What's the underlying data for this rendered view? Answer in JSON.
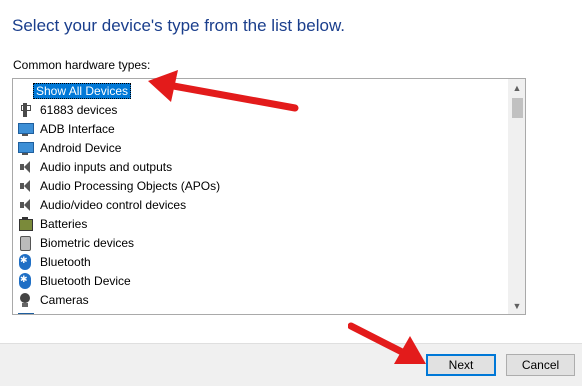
{
  "heading": "Select your device's type from the list below.",
  "section_label": "Common hardware types:",
  "list": {
    "items": [
      {
        "label": "Show All Devices",
        "icon": "none",
        "selected": true
      },
      {
        "label": "61883 devices",
        "icon": "usb-plug-icon"
      },
      {
        "label": "ADB Interface",
        "icon": "monitor-icon"
      },
      {
        "label": "Android Device",
        "icon": "monitor-icon"
      },
      {
        "label": "Audio inputs and outputs",
        "icon": "speaker-icon"
      },
      {
        "label": "Audio Processing Objects (APOs)",
        "icon": "speaker-icon"
      },
      {
        "label": "Audio/video control devices",
        "icon": "speaker-icon"
      },
      {
        "label": "Batteries",
        "icon": "battery-icon"
      },
      {
        "label": "Biometric devices",
        "icon": "biometric-icon"
      },
      {
        "label": "Bluetooth",
        "icon": "bluetooth-icon"
      },
      {
        "label": "Bluetooth Device",
        "icon": "bluetooth-icon"
      },
      {
        "label": "Cameras",
        "icon": "camera-icon"
      }
    ]
  },
  "buttons": {
    "next": "Next",
    "cancel": "Cancel"
  },
  "colors": {
    "heading": "#1a3e8c",
    "selection": "#0078d7",
    "annotation_arrow": "#e31b1b",
    "footer": "#f0f0f0"
  }
}
